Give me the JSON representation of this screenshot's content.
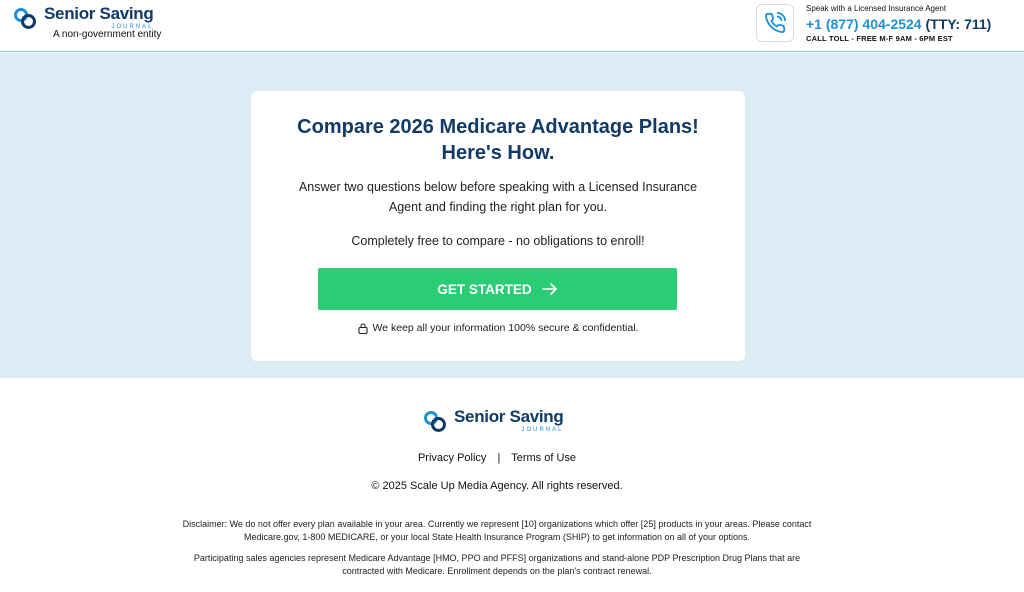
{
  "header": {
    "logo_name": "Senior Saving",
    "logo_sub": "JOURNAL",
    "tagline": "A non-government entity",
    "contact_label": "Speak with a Licensed Insurance Agent",
    "phone": "+1 (877) 404-2524",
    "tty": "(TTY: 711)",
    "hours": "CALL TOLL - FREE M-F 9AM - 6PM EST"
  },
  "hero": {
    "title": "Compare 2026 Medicare Advantage Plans! Here's How.",
    "description": "Answer two questions below before speaking with a Licensed Insurance Agent and finding the right plan for you.",
    "free_note": "Completely free to compare - no obligations to enroll!",
    "cta_label": "GET STARTED",
    "secure_note": "We keep all your information 100% secure & confidential."
  },
  "footer": {
    "logo_name": "Senior Saving",
    "logo_sub": "JOURNAL",
    "privacy_label": "Privacy Policy",
    "separator": "|",
    "terms_label": "Terms of Use",
    "copyright": "© 2025 Scale Up Media Agency. All rights reserved.",
    "disclaimer_1": "Disclaimer: We do not offer every plan available in your area. Currently we represent [10] organizations which offer [25] products in your areas. Please contact Medicare.gov, 1-800 MEDICARE, or your local State Health Insurance Program (SHIP) to get information on all of your options.",
    "disclaimer_2": "Participating sales agencies represent Medicare Advantage [HMO, PPO and PFFS] organizations and stand-alone PDP Prescription Drug Plans that are contracted with Medicare. Enrollment depends on the plan's contract renewal."
  },
  "icons": {
    "phone": "phone-icon",
    "arrow": "arrow-right-icon",
    "lock": "lock-icon"
  },
  "colors": {
    "brand_navy": "#123a66",
    "brand_blue": "#1e90d6",
    "cta_green": "#2bcd74",
    "hero_bg": "#dcecf5"
  }
}
